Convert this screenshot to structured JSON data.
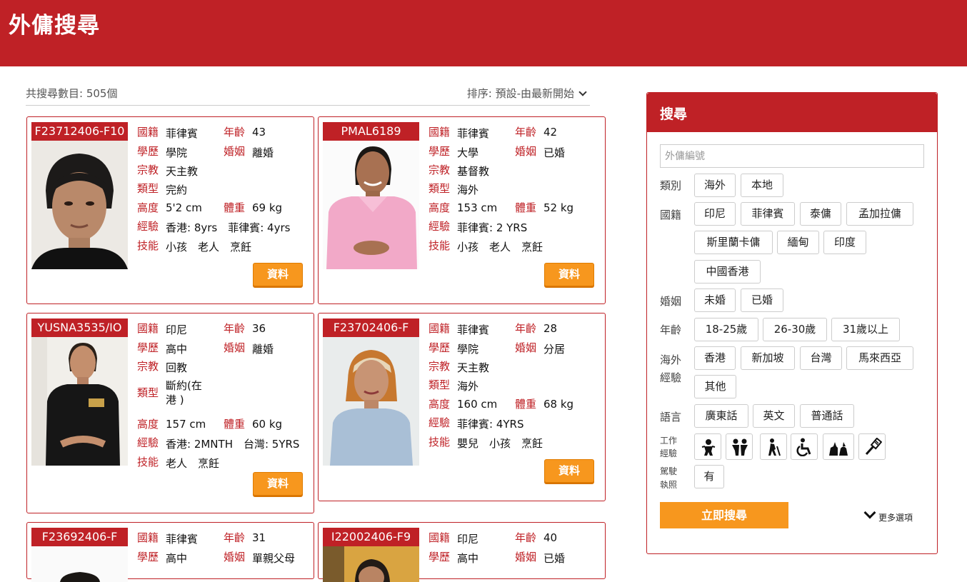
{
  "header": {
    "title": "外傭搜尋"
  },
  "summary": {
    "count": "共搜尋數目: 505個",
    "sort": "排序: 預設-由最新開始"
  },
  "labels": {
    "nationality": "國籍",
    "age": "年齡",
    "education": "學歷",
    "marital": "婚姻",
    "religion": "宗教",
    "type": "類型",
    "height": "高度",
    "weight": "體重",
    "experience": "經驗",
    "skills": "技能",
    "info_button": "資料"
  },
  "cards": [
    {
      "code": "F23712406-F10",
      "nationality": "菲律賓",
      "age": "43",
      "education": "學院",
      "marital": "離婚",
      "religion": "天主教",
      "type": "完約",
      "height": "5'2 cm",
      "weight": "69 kg",
      "experience": "香港: 8yrs　菲律賓: 4yrs",
      "skills": "小孩　老人　烹飪"
    },
    {
      "code": "PMAL6189",
      "nationality": "菲律賓",
      "age": "42",
      "education": "大學",
      "marital": "已婚",
      "religion": "基督教",
      "type": "海外",
      "height": "153 cm",
      "weight": "52 kg",
      "experience": "菲律賓: 2 YRS",
      "skills": "小孩　老人　烹飪"
    },
    {
      "code": "YUSNA3535/IO",
      "nationality": "印尼",
      "age": "36",
      "education": "高中",
      "marital": "離婚",
      "religion": "回教",
      "type_line1": "斷約(在",
      "type_line2": "港 )",
      "height": "157 cm",
      "weight": "60 kg",
      "experience": "香港: 2MNTH　台灣: 5YRS",
      "skills": "老人　烹飪"
    },
    {
      "code": "F23702406-F",
      "nationality": "菲律賓",
      "age": "28",
      "education": "學院",
      "marital": "分居",
      "religion": "天主教",
      "type": "海外",
      "height": "160 cm",
      "weight": "68 kg",
      "experience": "菲律賓: 4YRS",
      "skills": "嬰兒　小孩　烹飪"
    },
    {
      "code": "F23692406-F",
      "nationality": "菲律賓",
      "age": "31",
      "education": "高中",
      "marital": "單親父母"
    },
    {
      "code": "I22002406-F9",
      "nationality": "印尼",
      "age": "40",
      "education": "高中",
      "marital": "已婚"
    }
  ],
  "search": {
    "title": "搜尋",
    "placeholder": "外傭編號",
    "category_label": "類別",
    "categories": [
      "海外",
      "本地"
    ],
    "nationality_label": "國籍",
    "nationalities": [
      "印尼",
      "菲律賓",
      "泰傭",
      "孟加拉傭",
      "斯里蘭卡傭",
      "緬甸",
      "印度",
      "中國香港"
    ],
    "marital_label": "婚姻",
    "maritals": [
      "未婚",
      "已婚"
    ],
    "age_label": "年齡",
    "ages": [
      "18-25歲",
      "26-30歲",
      "31歲以上"
    ],
    "overseas_label_1": "海外",
    "overseas_label_2": "經驗",
    "overseas": [
      "香港",
      "新加坡",
      "台灣",
      "馬來西亞",
      "其他"
    ],
    "language_label": "語言",
    "languages": [
      "廣東話",
      "英文",
      "普通話"
    ],
    "work_label_1": "工作",
    "work_label_2": "經驗",
    "work_icons": [
      "baby-icon",
      "children-icon",
      "elderly-icon",
      "wheelchair-icon",
      "pets-icon",
      "cooking-icon"
    ],
    "license_label_1": "駕駛",
    "license_label_2": "執照",
    "license": "有",
    "submit": "立即搜尋",
    "more": "更多選項"
  },
  "colors": {
    "brand_red": "#bf2126",
    "accent_orange": "#f7971e"
  }
}
